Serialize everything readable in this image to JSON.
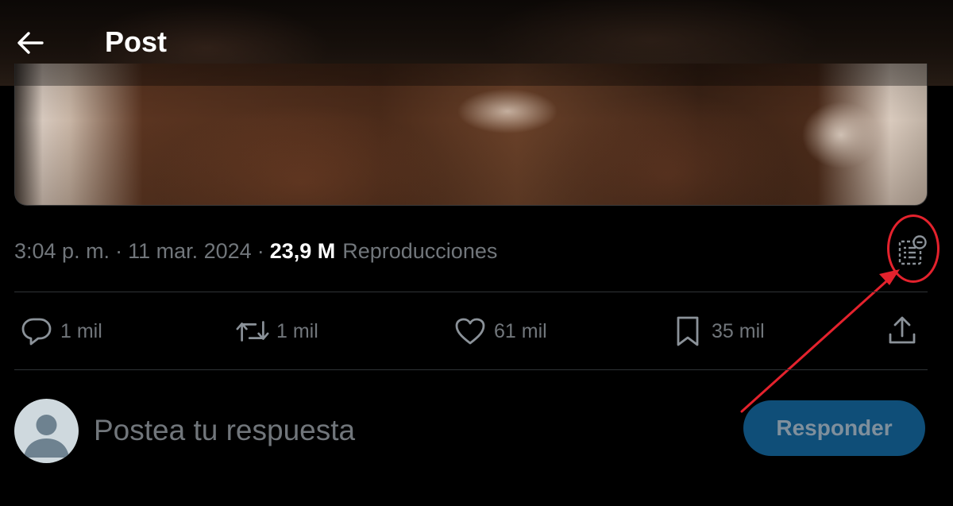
{
  "header": {
    "title": "Post",
    "back_icon": "arrow-left-icon"
  },
  "media": {
    "description_icon": "video-thumbnail"
  },
  "meta": {
    "time": "3:04 p. m.",
    "separator": "·",
    "date": "11 mar. 2024",
    "views_count": "23,9 M",
    "views_label": "Reproducciones",
    "notes_icon": "community-notes-icon"
  },
  "actions": {
    "reply": {
      "icon": "reply-icon",
      "count": "1 mil"
    },
    "repost": {
      "icon": "repost-icon",
      "count": "1 mil"
    },
    "like": {
      "icon": "heart-icon",
      "count": "61 mil"
    },
    "bookmark": {
      "icon": "bookmark-icon",
      "count": "35 mil"
    },
    "share": {
      "icon": "share-icon"
    }
  },
  "composer": {
    "placeholder": "Postea tu respuesta",
    "submit_label": "Responder"
  },
  "colors": {
    "background": "#000000",
    "muted_text": "#71767b",
    "primary_text": "#ffffff",
    "divider": "#2f3336",
    "button_bg": "#0f4e78",
    "annotation_red": "#e4222d"
  }
}
